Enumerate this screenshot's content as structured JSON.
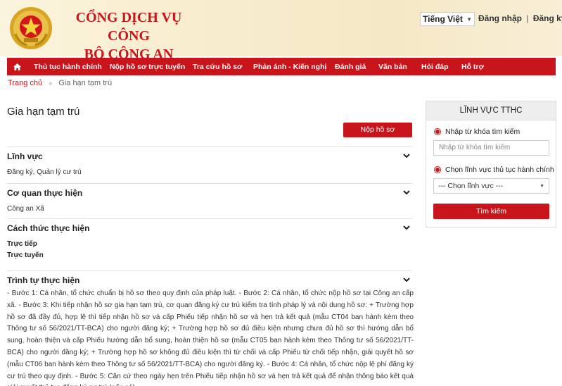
{
  "header": {
    "site_title_line1": "CỔNG DỊCH VỤ CÔNG",
    "site_title_line2": "BỘ CÔNG AN",
    "language": "Tiếng Việt",
    "login": "Đăng nhập",
    "separator": "|",
    "register": "Đăng ký"
  },
  "nav": {
    "home_icon": "home-icon",
    "items": [
      "Thủ tục hành chính",
      "Nộp hồ sơ trực tuyến",
      "Tra cứu hồ sơ",
      "Phản ánh - Kiến nghị",
      "Đánh giá",
      "Văn bản",
      "Hỏi đáp",
      "Hỗ trợ"
    ]
  },
  "breadcrumb": {
    "home": "Trang chủ",
    "separator": "»",
    "current": "Gia hạn tạm trú"
  },
  "main": {
    "title": "Gia hạn tạm trú",
    "submit_label": "Nộp hồ sơ",
    "sections": [
      {
        "title": "Lĩnh vực",
        "lines": [
          "Đăng ký, Quản lý cư trú"
        ]
      },
      {
        "title": "Cơ quan thực hiện",
        "lines": [
          "Công an Xã"
        ]
      },
      {
        "title": "Cách thức thực hiện",
        "lines": [
          "Trực tiếp",
          "Trực tuyến"
        ]
      },
      {
        "title": "Trình tự thực hiện",
        "text": "- Bước 1: Cá nhân, tổ chức chuẩn bị hồ sơ theo quy định của pháp luật. - Bước 2: Cá nhân, tổ chức nộp hồ sơ tại Công an cấp xã. - Bước 3: Khi tiếp nhận hồ sơ gia hạn tạm trú, cơ quan đăng ký cư trú kiểm tra tính pháp lý và nội dung hồ sơ: + Trường hợp hồ sơ đã đầy đủ, hợp lệ thì tiếp nhận hồ sơ và cấp Phiếu tiếp nhận hồ sơ và hẹn trả kết quả (mẫu CT04 ban hành kèm theo Thông tư số 56/2021/TT-BCA) cho người đăng ký; + Trường hợp hồ sơ đủ điều kiện nhưng chưa đủ hồ sơ thì hướng dẫn bổ sung, hoàn thiện và cấp Phiếu hướng dẫn bổ sung, hoàn thiện hồ sơ (mẫu CT05 ban hành kèm theo Thông tư số 56/2021/TT-BCA) cho người đăng ký; + Trường hợp hồ sơ không đủ điều kiện thì từ chối và cấp Phiếu từ chối tiếp nhận, giải quyết hồ sơ (mẫu CT06 ban hành kèm theo Thông tư số 56/2021/TT-BCA) cho người đăng ký. - Bước 4: Cá nhân, tổ chức nộp lệ phí đăng ký cư trú theo quy định. - Bước 5: Căn cứ theo ngày hẹn trên Phiếu tiếp nhận hồ sơ và hẹn trả kết quả để nhận thông báo kết quả giải quyết thủ tục đăng ký cư trú (nếu có)."
      }
    ]
  },
  "sidebar": {
    "title": "LĨNH VỰC TTHC",
    "option_keyword": "Nhập từ khóa tìm kiếm",
    "keyword_placeholder": "Nhập từ khóa tìm kiếm",
    "option_field": "Chọn lĩnh vực thủ tục hành chính",
    "field_select_value": "--- Chọn lĩnh vực ---",
    "search_label": "Tìm kiếm"
  },
  "colors": {
    "brand_red": "#c8141b",
    "header_bg": "#f7eccc"
  }
}
